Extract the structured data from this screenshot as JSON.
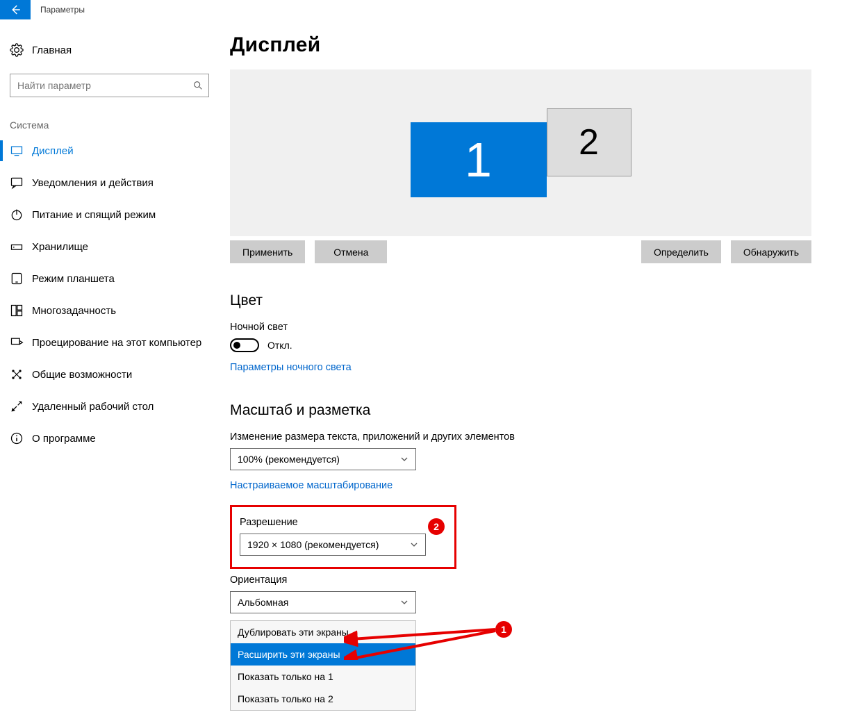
{
  "titlebar": {
    "title": "Параметры"
  },
  "sidebar": {
    "home": "Главная",
    "search_placeholder": "Найти параметр",
    "section": "Система",
    "items": [
      {
        "label": "Дисплей"
      },
      {
        "label": "Уведомления и действия"
      },
      {
        "label": "Питание и спящий режим"
      },
      {
        "label": "Хранилище"
      },
      {
        "label": "Режим планшета"
      },
      {
        "label": "Многозадачность"
      },
      {
        "label": "Проецирование на этот компьютер"
      },
      {
        "label": "Общие возможности"
      },
      {
        "label": "Удаленный рабочий стол"
      },
      {
        "label": "О программе"
      }
    ]
  },
  "main": {
    "title": "Дисплей",
    "monitors": {
      "one": "1",
      "two": "2"
    },
    "buttons": {
      "apply": "Применить",
      "cancel": "Отмена",
      "identify": "Определить",
      "detect": "Обнаружить"
    },
    "color_section": "Цвет",
    "night_light_label": "Ночной свет",
    "night_light_state": "Откл.",
    "night_light_link": "Параметры ночного света",
    "scale_section": "Масштаб и разметка",
    "scale_label": "Изменение размера текста, приложений и других элементов",
    "scale_value": "100% (рекомендуется)",
    "custom_scale_link": "Настраиваемое масштабирование",
    "resolution_label": "Разрешение",
    "resolution_value": "1920 × 1080 (рекомендуется)",
    "orientation_label": "Ориентация",
    "orientation_value": "Альбомная",
    "multimon_options": [
      "Дублировать эти экраны",
      "Расширить эти экраны",
      "Показать только на 1",
      "Показать только на 2"
    ],
    "callouts": {
      "c1": "1",
      "c2": "2"
    }
  }
}
